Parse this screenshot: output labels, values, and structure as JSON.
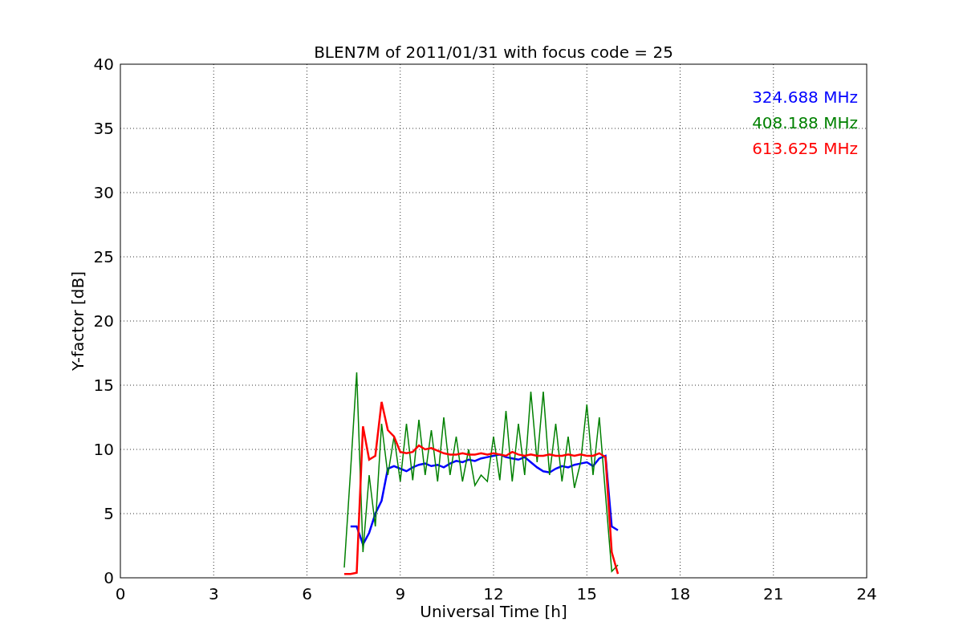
{
  "chart_data": {
    "type": "line",
    "title": "BLEN7M of 2011/01/31 with focus code = 25",
    "xlabel": "Universal Time [h]",
    "ylabel": "Y-factor [dB]",
    "x": [
      7.2,
      7.4,
      7.6,
      7.8,
      8.0,
      8.2,
      8.4,
      8.6,
      8.8,
      9.0,
      9.2,
      9.4,
      9.6,
      9.8,
      10.0,
      10.2,
      10.4,
      10.6,
      10.8,
      11.0,
      11.2,
      11.4,
      11.6,
      11.8,
      12.0,
      12.2,
      12.4,
      12.6,
      12.8,
      13.0,
      13.2,
      13.4,
      13.6,
      13.8,
      14.0,
      14.2,
      14.4,
      14.6,
      14.8,
      15.0,
      15.2,
      15.4,
      15.6,
      15.8,
      16.0
    ],
    "series": [
      {
        "name": "324.688 MHz",
        "color": "#0000ff",
        "values": [
          null,
          4,
          4,
          2.6,
          3.5,
          5,
          6,
          8.5,
          8.7,
          8.5,
          8.3,
          8.6,
          8.8,
          8.9,
          8.7,
          8.8,
          8.6,
          8.9,
          9.1,
          9,
          9.2,
          9.1,
          9.3,
          9.4,
          9.5,
          9.6,
          9.4,
          9.3,
          9.2,
          9.4,
          9,
          8.6,
          8.3,
          8.2,
          8.5,
          8.7,
          8.6,
          8.8,
          8.9,
          9,
          8.7,
          9.3,
          9.5,
          4,
          3.7
        ]
      },
      {
        "name": "408.188 MHz",
        "color": "#008000",
        "values": [
          0.8,
          8.3,
          16,
          2,
          8,
          4,
          12,
          8,
          11,
          7.5,
          12,
          7.6,
          12.3,
          8,
          11.5,
          7.5,
          12.5,
          8,
          11,
          7.5,
          10,
          7.2,
          8,
          7.5,
          11,
          7.6,
          13,
          7.5,
          12,
          8,
          14.5,
          9,
          14.5,
          8,
          12,
          7.5,
          11,
          7,
          9,
          13.5,
          8,
          12.5,
          6.5,
          0.5,
          1
        ]
      },
      {
        "name": "613.625 MHz",
        "color": "#ff0000",
        "values": [
          0.3,
          0.3,
          0.4,
          11.8,
          9.2,
          9.5,
          13.7,
          11.5,
          11,
          9.8,
          9.7,
          9.8,
          10.3,
          10,
          10.1,
          9.9,
          9.7,
          9.6,
          9.6,
          9.7,
          9.6,
          9.6,
          9.7,
          9.6,
          9.7,
          9.6,
          9.5,
          9.8,
          9.6,
          9.5,
          9.6,
          9.5,
          9.5,
          9.6,
          9.5,
          9.5,
          9.6,
          9.5,
          9.6,
          9.5,
          9.5,
          9.7,
          9.4,
          2,
          0.3
        ]
      }
    ],
    "grid": true,
    "xlim": [
      0,
      24
    ],
    "ylim": [
      0,
      40
    ],
    "xticks": [
      0,
      3,
      6,
      9,
      12,
      15,
      18,
      21,
      24
    ],
    "yticks": [
      0,
      5,
      10,
      15,
      20,
      25,
      30,
      35,
      40
    ]
  }
}
